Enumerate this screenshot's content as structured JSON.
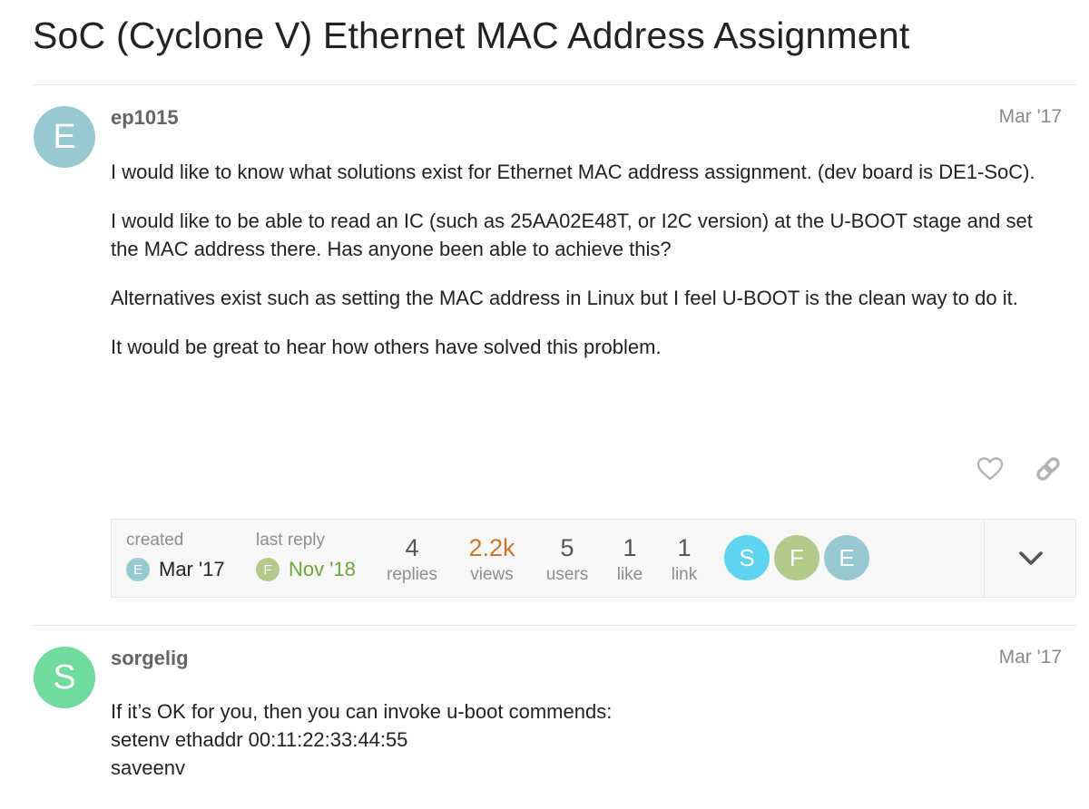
{
  "topic": {
    "title": "SoC (Cyclone V) Ethernet MAC Address Assignment"
  },
  "posts": [
    {
      "avatar_letter": "E",
      "avatar_color": "#98c9d1",
      "username": "ep1015",
      "date": "Mar '17",
      "paragraphs": [
        "I would like to know what solutions exist for Ethernet MAC address assignment. (dev board is DE1-SoC).",
        "I would like to be able to read an IC (such as 25AA02E48T, or I2C version) at the U-BOOT stage and set the MAC address there. Has anyone been able to achieve this?",
        "Alternatives exist such as setting the MAC address in Linux but I feel U-BOOT is the clean way to do it.",
        "It would be great to hear how others have solved this problem."
      ],
      "actions": {
        "like_icon": "heart-icon",
        "share_icon": "link-icon"
      }
    },
    {
      "avatar_letter": "S",
      "avatar_color": "#6fdc9d",
      "username": "sorgelig",
      "date": "Mar '17",
      "lines": [
        "If it’s OK for you, then you can invoke u-boot commends:",
        "setenv ethaddr 00:11:22:33:44:55",
        "saveenv"
      ]
    }
  ],
  "topic_map": {
    "created": {
      "label": "created",
      "avatar_letter": "E",
      "avatar_color": "#98c9d1",
      "date": "Mar '17"
    },
    "last_reply": {
      "label": "last reply",
      "avatar_letter": "F",
      "avatar_color": "#b2cb8b",
      "date": "Nov '18",
      "date_color": "#6aa53b"
    },
    "stats": [
      {
        "value": "4",
        "label": "replies"
      },
      {
        "value": "2.2k",
        "label": "views",
        "value_color": "#c5782e"
      },
      {
        "value": "5",
        "label": "users"
      },
      {
        "value": "1",
        "label": "like"
      },
      {
        "value": "1",
        "label": "link"
      }
    ],
    "participants": [
      {
        "letter": "S",
        "color": "#5fd4f0"
      },
      {
        "letter": "F",
        "color": "#b2cb8b"
      },
      {
        "letter": "E",
        "color": "#98c9d1"
      }
    ],
    "expand_icon": "chevron-down-icon"
  }
}
